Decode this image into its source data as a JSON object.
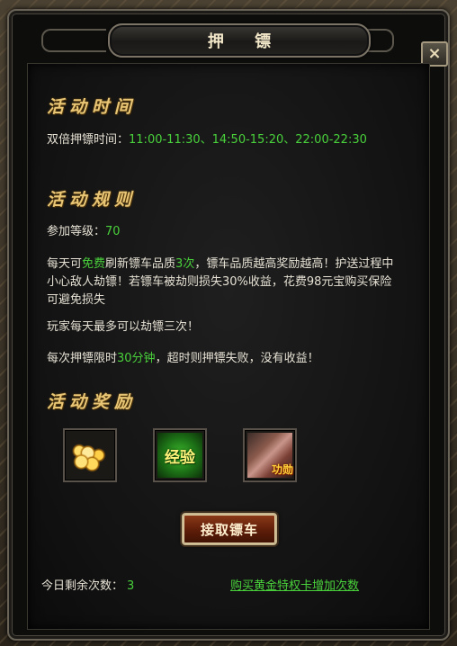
{
  "window": {
    "title": "押 镖",
    "close_label": "×"
  },
  "time_section": {
    "title": "活动时间",
    "label": "双倍押镖时间：",
    "value": "11:00-11:30、14:50-15:20、22:00-22:30"
  },
  "rules_section": {
    "title": "活动规则",
    "level_label": "参加等级：",
    "level_value": "70",
    "refresh_prefix": "每天可",
    "refresh_free": "免费",
    "refresh_mid": "刷新镖车品质",
    "refresh_times": "3次",
    "refresh_suffix": "，镖车品质越高奖励越高！护送过程中小心敌人劫镖！若镖车被劫则损失30%收益，花费98元宝购买保险可避免损失",
    "rob_rule": "玩家每天最多可以劫镖三次！",
    "time_limit_prefix": "每次押镖限时",
    "time_limit_value": "30分钟",
    "time_limit_suffix": "，超时则押镖失败，没有收益！"
  },
  "rewards_section": {
    "title": "活动奖励",
    "items": [
      {
        "icon": "gold-coins-icon"
      },
      {
        "icon": "experience-icon",
        "label": "经验"
      },
      {
        "icon": "merit-scroll-icon",
        "label": "功勋"
      }
    ]
  },
  "escort_button": {
    "label": "接取镖车"
  },
  "footer": {
    "remaining_label": "今日剩余次数：",
    "remaining_value": "3",
    "buy_link": "购买黄金特权卡增加次数"
  },
  "colors": {
    "highlight": "#49d13b",
    "section_title": "#e8c675",
    "text": "#e6e1d4"
  }
}
